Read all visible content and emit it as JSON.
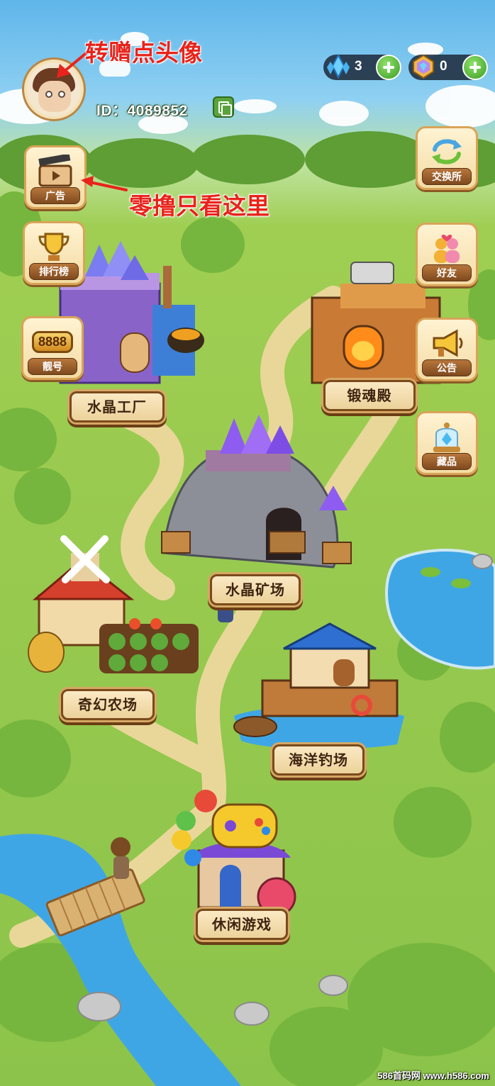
{
  "annotations": {
    "avatar_hint": "转赠点头像",
    "ad_hint": "零撸只看这里"
  },
  "profile": {
    "id_text": "ID：4089852"
  },
  "currencies": [
    {
      "icon": "blue-crystal-icon",
      "value": "3"
    },
    {
      "icon": "rainbow-gem-icon",
      "value": "0"
    }
  ],
  "left_menu": [
    {
      "icon": "clapperboard-icon",
      "label": "广告"
    },
    {
      "icon": "trophy-icon",
      "label": "排行榜"
    },
    {
      "icon": "lucky-number-icon",
      "label": "靓号",
      "badge": "8888"
    }
  ],
  "right_menu": [
    {
      "icon": "exchange-arrows-icon",
      "label": "交换所"
    },
    {
      "icon": "friends-icon",
      "label": "好友"
    },
    {
      "icon": "megaphone-icon",
      "label": "公告"
    },
    {
      "icon": "collection-jar-icon",
      "label": "藏品"
    }
  ],
  "locations": [
    {
      "name": "水晶工厂"
    },
    {
      "name": "锻魂殿"
    },
    {
      "name": "水晶矿场"
    },
    {
      "name": "奇幻农场"
    },
    {
      "name": "海洋钓场"
    },
    {
      "name": "休闲游戏"
    }
  ],
  "watermark": "586首码网 www.h586.com",
  "colors": {
    "annotation_red": "#e8231b",
    "sign_wood": "#7a4a1c",
    "grass": "#8cc34a",
    "water": "#3fa6e6"
  }
}
